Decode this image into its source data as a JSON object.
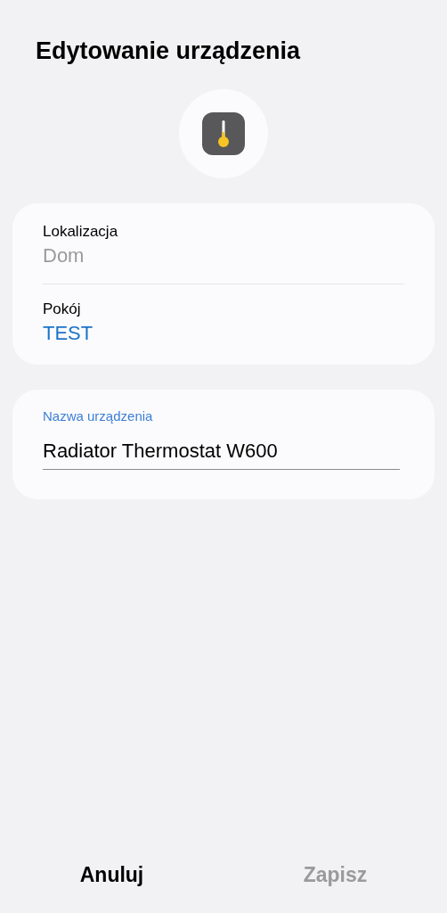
{
  "title": "Edytowanie urządzenia",
  "fields": [
    {
      "label": "Lokalizacja",
      "value": "Dom",
      "disabled": true
    },
    {
      "label": "Pokój",
      "value": "TEST",
      "disabled": false
    }
  ],
  "name_field": {
    "label": "Nazwa urządzenia",
    "value": "Radiator Thermostat W600"
  },
  "buttons": [
    {
      "label": "Anuluj",
      "disabled": false
    },
    {
      "label": "Zapisz",
      "disabled": true
    }
  ]
}
